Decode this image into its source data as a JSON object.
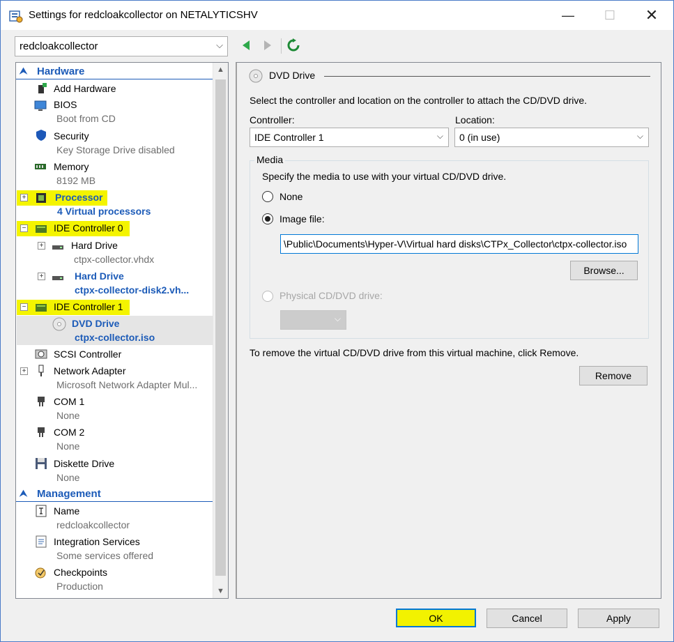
{
  "window": {
    "title": "Settings for redcloakcollector on NETALYTICSHV",
    "minimize": "—",
    "maximize": "☐",
    "close": "✕"
  },
  "vm_selector": {
    "value": "redcloakcollector",
    "chevron": "⌵"
  },
  "tree": {
    "hardware_section": "Hardware",
    "management_section": "Management",
    "items": [
      {
        "label": "Add Hardware",
        "sub": ""
      },
      {
        "label": "BIOS",
        "sub": "Boot from CD"
      },
      {
        "label": "Security",
        "sub": "Key Storage Drive disabled"
      },
      {
        "label": "Memory",
        "sub": "8192 MB"
      },
      {
        "label": "Processor",
        "sub": "4 Virtual processors"
      },
      {
        "label": "IDE Controller 0",
        "sub": ""
      },
      {
        "label": "Hard Drive",
        "sub": "ctpx-collector.vhdx"
      },
      {
        "label": "Hard Drive",
        "sub": "ctpx-collector-disk2.vh..."
      },
      {
        "label": "IDE Controller 1",
        "sub": ""
      },
      {
        "label": "DVD Drive",
        "sub": "ctpx-collector.iso"
      },
      {
        "label": "SCSI Controller",
        "sub": ""
      },
      {
        "label": "Network Adapter",
        "sub": "Microsoft Network Adapter Mul..."
      },
      {
        "label": "COM 1",
        "sub": "None"
      },
      {
        "label": "COM 2",
        "sub": "None"
      },
      {
        "label": "Diskette Drive",
        "sub": "None"
      }
    ],
    "management_items": [
      {
        "label": "Name",
        "sub": "redcloakcollector"
      },
      {
        "label": "Integration Services",
        "sub": "Some services offered"
      },
      {
        "label": "Checkpoints",
        "sub": "Production"
      }
    ]
  },
  "panel": {
    "heading": "DVD Drive",
    "intro": "Select the controller and location on the controller to attach the CD/DVD drive.",
    "controller_label": "Controller:",
    "controller_value": "IDE Controller 1",
    "location_label": "Location:",
    "location_value": "0 (in use)",
    "media_title": "Media",
    "media_desc": "Specify the media to use with your virtual CD/DVD drive.",
    "none_label": "None",
    "image_label": "Image file:",
    "image_path": "\\Public\\Documents\\Hyper-V\\Virtual hard disks\\CTPx_Collector\\ctpx-collector.iso",
    "browse_label": "Browse...",
    "physical_label": "Physical CD/DVD drive:",
    "remove_desc": "To remove the virtual CD/DVD drive from this virtual machine, click Remove.",
    "remove_label": "Remove",
    "selected_media": "image_file"
  },
  "footer": {
    "ok": "OK",
    "cancel": "Cancel",
    "apply": "Apply"
  },
  "colors": {
    "highlight": "#f4f400",
    "accent_blue": "#1c5bb8",
    "focus_border": "#0078d7"
  }
}
